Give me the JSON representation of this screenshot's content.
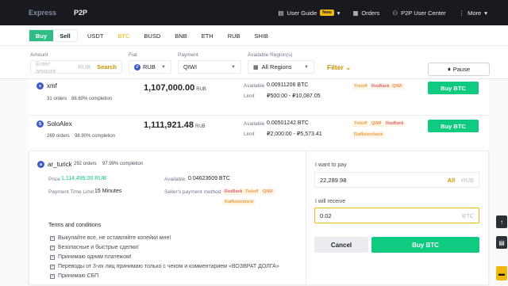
{
  "topnav": {
    "express": "Express",
    "p2p": "P2P",
    "user_guide": "User Guide",
    "new_badge": "New",
    "orders": "Orders",
    "user_center": "P2P User Center",
    "more": "More"
  },
  "trade": {
    "buy": "Buy",
    "sell": "Sell",
    "coins": [
      "USDT",
      "BTC",
      "BUSD",
      "BNB",
      "ETH",
      "RUB",
      "SHIB"
    ],
    "active_coin": "BTC"
  },
  "filters": {
    "amount_label": "Amount",
    "amount_placeholder": "Enter amount",
    "amount_unit": "RUB",
    "search": "Search",
    "fiat_label": "Fiat",
    "fiat_value": "RUB",
    "payment_label": "Payment",
    "payment_value": "QIWI",
    "region_label": "Available Region(s)",
    "region_value": "All Regions",
    "filter": "Filter",
    "pause": "Pause"
  },
  "offers": [
    {
      "name": "xmf",
      "initial": "x",
      "orders": "31 orders",
      "completion": "88.60% completion",
      "price": "1,107,000.00",
      "currency": "RUB",
      "available_label": "Available",
      "available": "0.00911206 BTC",
      "limit_label": "Limit",
      "limit": "₽500.00 - ₽10,087.05",
      "methods": [
        "Tinkoff",
        "RosBank",
        "QIWI"
      ],
      "button": "Buy BTC"
    },
    {
      "name": "SoloAlex",
      "initial": "S",
      "orders": "269 orders",
      "completion": "98.90% completion",
      "price": "1,111,921.48",
      "currency": "RUB",
      "available_label": "Available",
      "available": "0.00501242 BTC",
      "limit_label": "Limit",
      "limit": "₽2,000.00 - ₽5,573.41",
      "methods": [
        "Tinkoff",
        "QIWI",
        "RosBank",
        "Raiffeisenbank"
      ],
      "button": "Buy BTC"
    }
  ],
  "expanded": {
    "name": "ar_turick",
    "initial": "a",
    "orders": "292 orders",
    "completion": "97.99% completion",
    "price_label": "Price",
    "price": "1,114,499.00 RUB",
    "available_label": "Available",
    "available": "0.04623609 BTC",
    "time_label": "Payment Time Limit",
    "time": "15 Minutes",
    "method_label": "Seller's payment method",
    "methods": [
      "RosBank",
      "Tinkoff",
      "QIWI",
      "Raiffeisenbank"
    ],
    "terms_title": "Terms and conditions",
    "terms": [
      "Выкупайте все, не оставляйте копейки мне!",
      "Безопасные и быстрые сделки!",
      "Принимаю одним платежом!",
      "Переводы от 3-их лиц принимаю только с чеком и комментарием «ВОЗВРАТ ДОЛГА»",
      "Принимаю СБП"
    ],
    "pay_label": "I want to pay",
    "pay_value": "22,289.98",
    "pay_all": "All",
    "pay_unit": "RUB",
    "receive_label": "I will receive",
    "receive_value": "0.02",
    "receive_unit": "BTC",
    "cancel": "Cancel",
    "buy": "Buy BTC"
  },
  "colors": {
    "accent": "#f0b90b",
    "buy_green": "#0ecb81",
    "dark_bg": "#181a20"
  }
}
